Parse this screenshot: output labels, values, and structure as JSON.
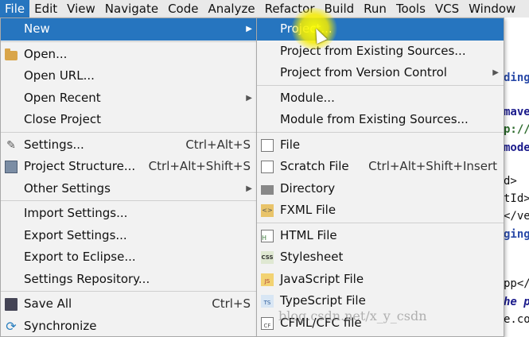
{
  "menubar": {
    "items": [
      "File",
      "Edit",
      "View",
      "Navigate",
      "Code",
      "Analyze",
      "Refactor",
      "Build",
      "Run",
      "Tools",
      "VCS",
      "Window"
    ]
  },
  "file_menu": {
    "new": "New",
    "open": "Open...",
    "open_url": "Open URL...",
    "open_recent": "Open Recent",
    "close_project": "Close Project",
    "settings": "Settings...",
    "settings_sc": "Ctrl+Alt+S",
    "project_structure": "Project Structure...",
    "project_structure_sc": "Ctrl+Alt+Shift+S",
    "other_settings": "Other Settings",
    "import_settings": "Import Settings...",
    "export_settings": "Export Settings...",
    "export_eclipse": "Export to Eclipse...",
    "settings_repo": "Settings Repository...",
    "save_all": "Save All",
    "save_all_sc": "Ctrl+S",
    "synchronize": "Synchronize"
  },
  "new_submenu": {
    "project": "Project...",
    "from_existing": "Project from Existing Sources...",
    "from_vcs": "Project from Version Control",
    "module": "Module...",
    "module_existing": "Module from Existing Sources...",
    "file": "File",
    "scratch": "Scratch File",
    "scratch_sc": "Ctrl+Alt+Shift+Insert",
    "directory": "Directory",
    "fxml": "FXML File",
    "html": "HTML File",
    "stylesheet": "Stylesheet",
    "javascript": "JavaScript File",
    "typescript": "TypeScript File",
    "cfml": "CFML/CFC file"
  },
  "editor_lines": [
    "ding",
    "mave",
    "p://",
    "mode",
    "d>",
    "tId>",
    "</ve",
    "ging",
    "pp</",
    "he p",
    "e.com"
  ],
  "watermark": "blog.csdn.net/x_y_csdn",
  "colors": {
    "highlight": "#2675bf",
    "menu_bg": "#f2f2f2"
  }
}
